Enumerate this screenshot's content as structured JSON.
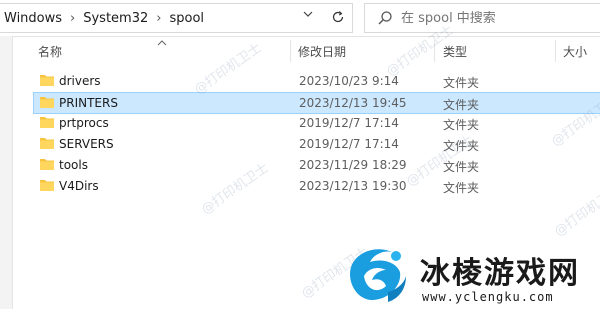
{
  "address": {
    "crumbs": [
      "Windows",
      "System32",
      "spool"
    ],
    "separator": "›"
  },
  "search": {
    "placeholder": "在 spool 中搜索"
  },
  "columns": {
    "name": "名称",
    "date": "修改日期",
    "type": "类型",
    "size": "大小"
  },
  "files": [
    {
      "name": "drivers",
      "date": "2023/10/23 9:14",
      "type": "文件夹"
    },
    {
      "name": "PRINTERS",
      "date": "2023/12/13 19:45",
      "type": "文件夹"
    },
    {
      "name": "prtprocs",
      "date": "2019/12/7 17:14",
      "type": "文件夹"
    },
    {
      "name": "SERVERS",
      "date": "2019/12/7 17:14",
      "type": "文件夹"
    },
    {
      "name": "tools",
      "date": "2023/11/29 18:29",
      "type": "文件夹"
    },
    {
      "name": "V4Dirs",
      "date": "2023/12/13 19:30",
      "type": "文件夹"
    }
  ],
  "selected_index": 1,
  "watermark": "@打印机卫士",
  "brand": {
    "name": "冰棱游戏网",
    "url": "www.yclengku.com"
  },
  "colors": {
    "selection": "#cce8ff",
    "folder": "#f5c542",
    "accent": "#1a9ee0"
  },
  "icons": [
    "chevron-down-icon",
    "refresh-icon",
    "search-icon",
    "folder-icon",
    "sort-up-icon"
  ]
}
